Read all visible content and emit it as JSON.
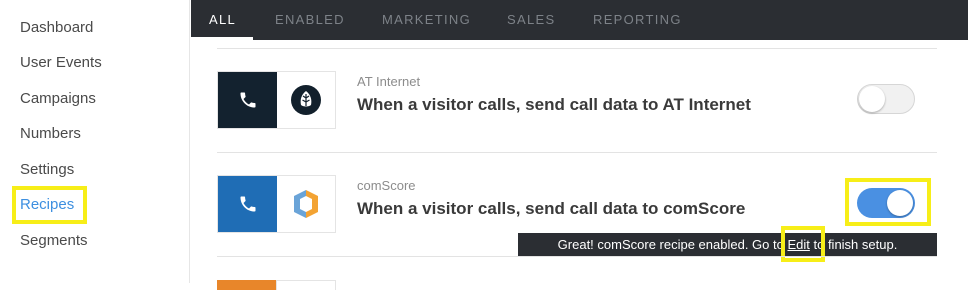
{
  "sidebar": {
    "items": [
      {
        "label": "Dashboard"
      },
      {
        "label": "User Events"
      },
      {
        "label": "Campaigns"
      },
      {
        "label": "Numbers"
      },
      {
        "label": "Settings"
      },
      {
        "label": "Recipes",
        "active": true
      },
      {
        "label": "Segments"
      }
    ]
  },
  "tabs": [
    {
      "label": "ALL",
      "active": true
    },
    {
      "label": "ENABLED"
    },
    {
      "label": "MARKETING"
    },
    {
      "label": "SALES"
    },
    {
      "label": "REPORTING"
    }
  ],
  "recipes": [
    {
      "vendor": "AT Internet",
      "title": "When a visitor calls, send call data to AT Internet",
      "enabled": false,
      "left_icon": "phone-icon",
      "right_icon": "at-internet-logo-icon",
      "left_color": "#13222f"
    },
    {
      "vendor": "comScore",
      "title": "When a visitor calls, send call data to comScore",
      "enabled": true,
      "left_icon": "phone-icon",
      "right_icon": "comscore-logo-icon",
      "left_color": "#1f6db5"
    }
  ],
  "toast": {
    "before": "Great! comScore recipe enabled. Go to ",
    "link": "Edit",
    "after": " to finish setup."
  },
  "colors": {
    "highlight": "#f7ee18",
    "accent": "#4a90e2",
    "dark_bar": "#2b2e33"
  }
}
